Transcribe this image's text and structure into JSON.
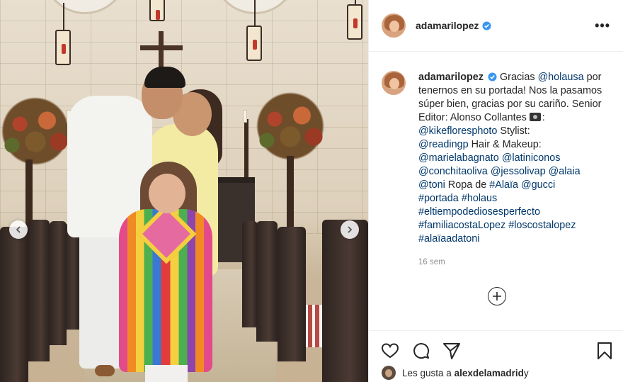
{
  "post": {
    "author": "adamarilopez",
    "verified_icon": "verified-badge-icon",
    "more_icon": "•••"
  },
  "caption": {
    "author": "adamarilopez",
    "t1": " Gracias ",
    "m1": "@holausa",
    "t2": " por tenernos en su portada! Nos la pasamos súper bien, gracias por su cariño. Senior Editor: Alonso Collantes ",
    "t3": ": ",
    "m2": "@kikefloresphoto",
    "t4": " Stylist: ",
    "m3": "@readingp",
    "t5": " Hair & Makeup: ",
    "m4": "@marielabagnato",
    "m5": "@latiniconos",
    "m6": "@conchitaoliva",
    "m7": "@jessolivap",
    "m8": "@alaia",
    "m9": "@toni",
    "t6": " Ropa de ",
    "m10": "#Alaïa",
    "m11": "@gucci",
    "h1": "#portada",
    "h2": "#holaus",
    "h3": "#eltiempodediosesperfecto",
    "h4": "#familiacostaLopez",
    "h5": "#loscostalopez",
    "h6": "#alaïaadatoni"
  },
  "timestamp": "16 sem",
  "likes": {
    "prefix": "Les gusta a ",
    "user": "alexdelamadrid",
    "suffix": " y"
  },
  "colors": {
    "link": "#00376b",
    "verified": "#3897f0",
    "muted": "#8e8e8e",
    "text": "#262626"
  }
}
